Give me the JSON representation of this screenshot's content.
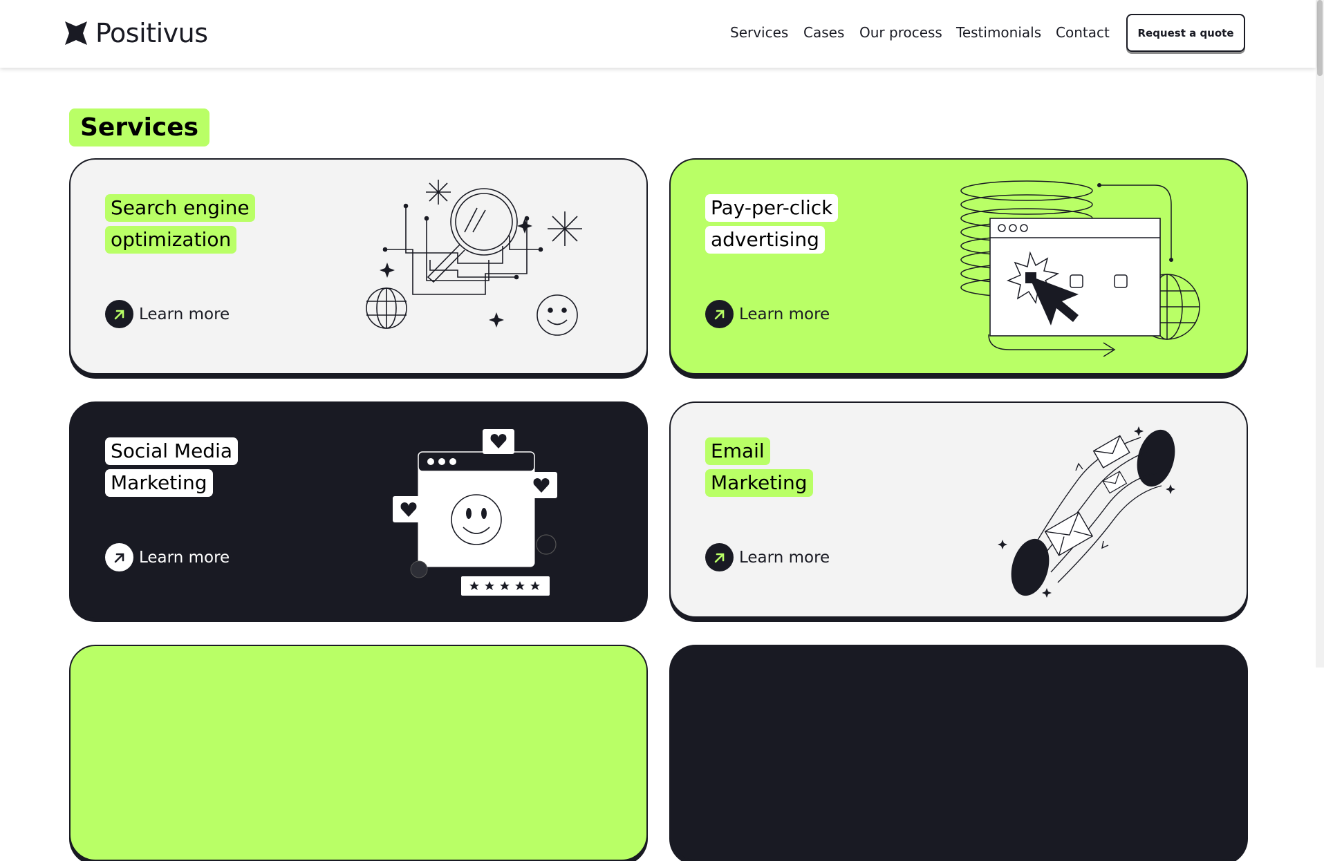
{
  "brand": {
    "name": "Positivus"
  },
  "nav": {
    "items": [
      "Services",
      "Cases",
      "Our process",
      "Testimonials",
      "Contact"
    ],
    "cta": "Request a quote"
  },
  "section": {
    "title": "Services"
  },
  "cards": [
    {
      "title_lines": [
        "Search engine",
        "optimization"
      ],
      "learn": "Learn more",
      "theme": "light",
      "illustration": "magnifier-icon"
    },
    {
      "title_lines": [
        "Pay-per-click",
        "advertising"
      ],
      "learn": "Learn more",
      "theme": "green",
      "illustration": "click-cursor-icon"
    },
    {
      "title_lines": [
        "Social Media",
        "Marketing"
      ],
      "learn": "Learn more",
      "theme": "dark",
      "illustration": "social-browser-icon"
    },
    {
      "title_lines": [
        "Email",
        "Marketing"
      ],
      "learn": "Learn more",
      "theme": "light",
      "illustration": "email-portal-icon"
    }
  ],
  "colors": {
    "accent": "#B9FF66",
    "dark": "#191A23",
    "light": "#F3F3F3"
  }
}
